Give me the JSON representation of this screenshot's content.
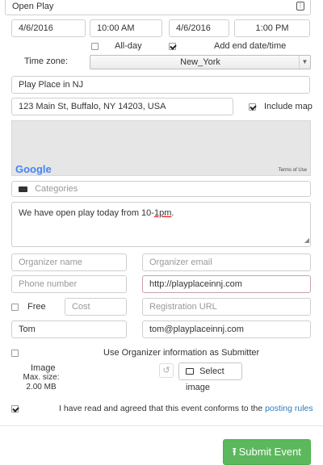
{
  "event": {
    "title": "Open Play",
    "start_date": "4/6/2016",
    "start_time": "10:00 AM",
    "end_date": "4/6/2016",
    "end_time": "1:00 PM",
    "all_day_label": "All-day",
    "add_end_label": "Add end date/time",
    "timezone_label": "Time zone:",
    "timezone_value": "New_York",
    "venue": "Play Place in NJ",
    "address": "123 Main St, Buffalo, NY 14203, USA",
    "include_map_label": "Include map",
    "map_logo": "Google",
    "map_terms": "Terms of Use",
    "categories_placeholder": "Categories",
    "description_prefix": "We have open play today from 10-",
    "description_underlined": "1pm",
    "description_suffix": "."
  },
  "organizer": {
    "name_placeholder": "Organizer name",
    "email_placeholder": "Organizer email",
    "phone_placeholder": "Phone number",
    "website": "http://playplaceinnj.com",
    "free_label": "Free",
    "cost_placeholder": "Cost",
    "registration_placeholder": "Registration URL",
    "submitter_name": "Tom",
    "submitter_email": "tom@playplaceinnj.com",
    "use_as_submitter_label": "Use Organizer information as Submitter"
  },
  "image": {
    "label": "Image",
    "max_size": "Max. size: 2.00 MB",
    "select_button": "Select image"
  },
  "agree": {
    "text": "I have read and agreed that this event conforms to the",
    "link": "posting rules"
  },
  "submit_label": "Submit Event",
  "colors": {
    "submit_green": "#5cb85c",
    "link_blue": "#337ab7"
  }
}
